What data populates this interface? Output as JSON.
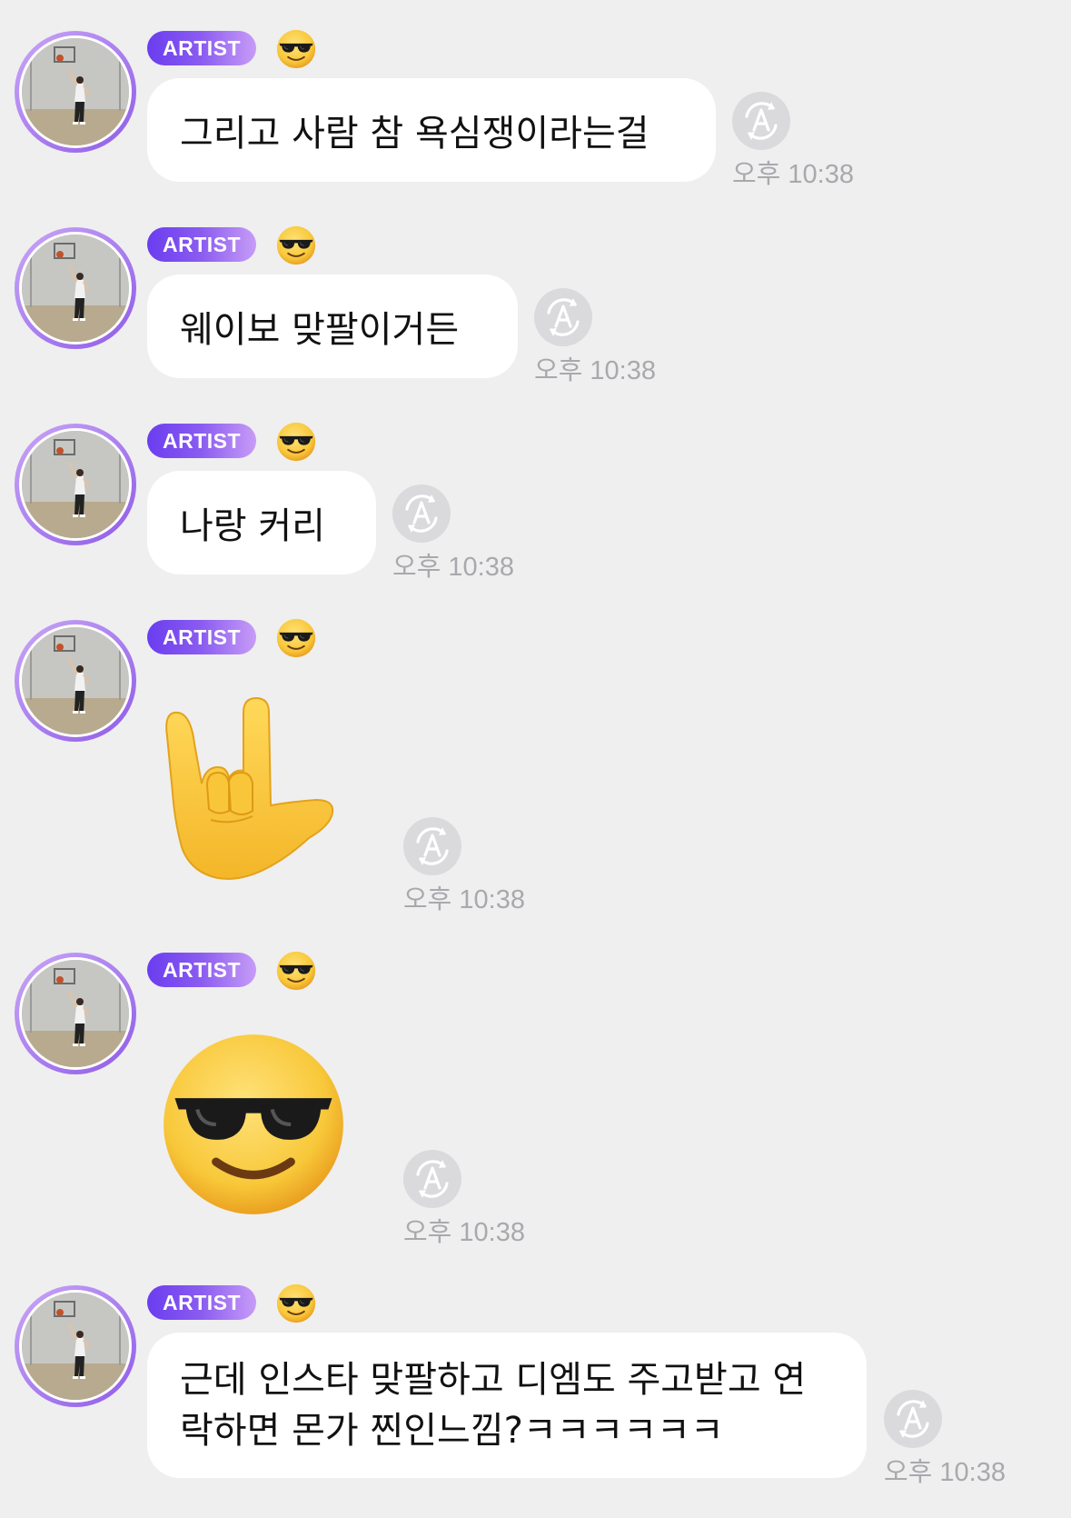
{
  "badge_label": "ARTIST",
  "badge_emoji": "smiling-face-with-sunglasses",
  "colors": {
    "background": "#efeff0",
    "bubble": "#ffffff",
    "badge_start": "#6a3df0",
    "badge_end": "#c79cf7",
    "time_text": "#a9a9ad"
  },
  "messages": [
    {
      "type": "text",
      "text": "그리고 사람 참 욕심쟁이라는걸",
      "time": "오후 10:38"
    },
    {
      "type": "text",
      "text": "웨이보 맞팔이거든",
      "time": "오후 10:38"
    },
    {
      "type": "text",
      "text": "나랑 커리",
      "time": "오후 10:38"
    },
    {
      "type": "emoji",
      "emoji": "love-you-gesture",
      "time": "오후 10:38"
    },
    {
      "type": "emoji",
      "emoji": "smiling-face-with-sunglasses",
      "time": "오후 10:38"
    },
    {
      "type": "text",
      "text": "근데 인스타 맞팔하고 디엠도 주고받고 연락하면 몬가 찐인느낌?ㅋㅋㅋㅋㅋㅋ",
      "time": "오후 10:38"
    }
  ]
}
